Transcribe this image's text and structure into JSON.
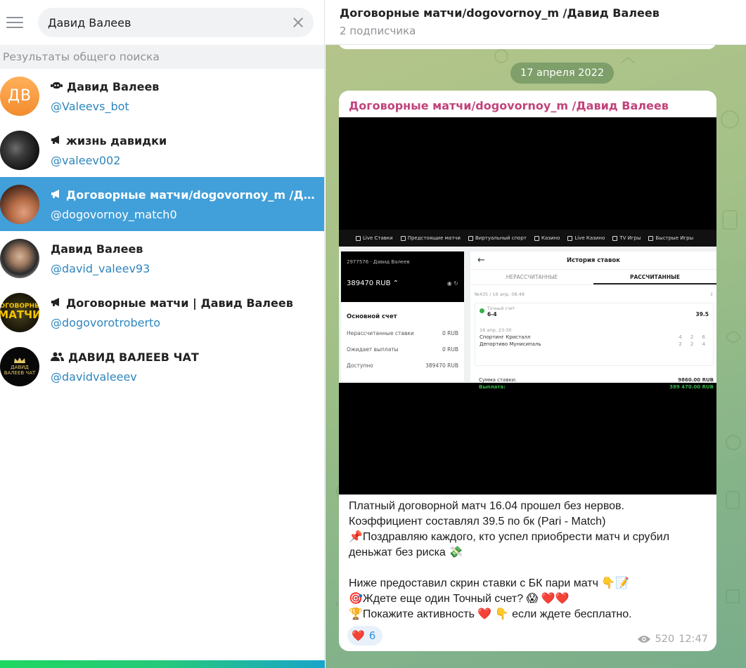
{
  "search": {
    "query": "Давид Валеев"
  },
  "section_title": "Результаты общего поиска",
  "results": [
    {
      "title": "Давид Валеев",
      "handle": "@Valeevs_bot",
      "icon": "bot-icon",
      "avatar_text": "ДВ",
      "avatar_color": "#f59a3e"
    },
    {
      "title": "жизнь давидки",
      "handle": "@valeev002",
      "icon": "megaphone-icon"
    },
    {
      "title": "Договорные матчи/dogovornoy_m /Давид Валеев",
      "handle": "@dogovornoy_match0",
      "icon": "megaphone-icon",
      "active": true
    },
    {
      "title": "Давид Валеев",
      "handle": "@david_valeev93",
      "icon": ""
    },
    {
      "title": "Договорные матчи | Давид Валеев",
      "handle": "@dogovorotroberto",
      "icon": "megaphone-icon",
      "avatar_text_top": "ДОГОВОРНЫЕ",
      "avatar_text_big": "МАТЧИ"
    },
    {
      "title": "ДАВИД ВАЛЕЕВ ЧАТ",
      "handle": "@davidvaleeev",
      "icon": "group-icon",
      "avatar_text": "ДАВИД ВАЛЕЕВ ЧАТ"
    }
  ],
  "chat": {
    "title": "Договорные матчи/dogovornoy_m /Давид Валеев",
    "subscribers": "2 подписчика",
    "date": "17 апреля 2022",
    "message": {
      "sender": "Договорные матчи/dogovornoy_m /Давид Валеев",
      "text_lines": [
        "Платный договорной матч 16.04 прошел без нервов.",
        "Коэффициент составлял 39.5 по бк (Pari - Match)",
        "📌Поздравляю каждого, кто успел приобрести матч и срубил",
        "деньжат без риска 💸",
        "",
        "Ниже предоставил скрин ставки с БК пари матч 👇📝",
        "🎯Ждете еще один Точный счет? 😱 ❤️❤️",
        "🏆Покажите активность ❤️ 👇 если ждете бесплатно."
      ],
      "reaction": {
        "emoji": "❤️",
        "count": "6"
      },
      "views": "520",
      "time": "12:47"
    }
  },
  "screenshot": {
    "nav": [
      "Live Ставки",
      "Предстоящие матчи",
      "Виртуальный спорт",
      "Казино",
      "Live Казино",
      "TV Игры",
      "Быстрые Игры"
    ],
    "account_id": "2977576 · Давид Валеев",
    "balance": "389470 RUB ⌃",
    "main_account": "Основной счет",
    "lines": [
      {
        "label": "Нерассчитанные ставки",
        "value": "0 RUB"
      },
      {
        "label": "Ожидает выплаты",
        "value": "0 RUB"
      },
      {
        "label": "Доступно",
        "value": "389470 RUB"
      }
    ],
    "history_title": "История ставок",
    "tabs": [
      "НЕРАССЧИТАННЫЕ",
      "РАССЧИТАННЫЕ"
    ],
    "bet_id": "№435 / 16 апр, 08:48",
    "exact_label": "Точный счет",
    "exact_score": "6-4",
    "odds": "39.5",
    "match_time": "16 апр, 23:30",
    "team1": "Спортинг Кристалл",
    "team1_score": "4 2 6",
    "team2": "Депортиво Мунисипаль",
    "team2_score": "2 2 4",
    "stake_label": "Сумма ставки:",
    "stake": "9860.00 RUB",
    "payout_label": "Выплата:",
    "payout": "389 470.00 RUB"
  }
}
